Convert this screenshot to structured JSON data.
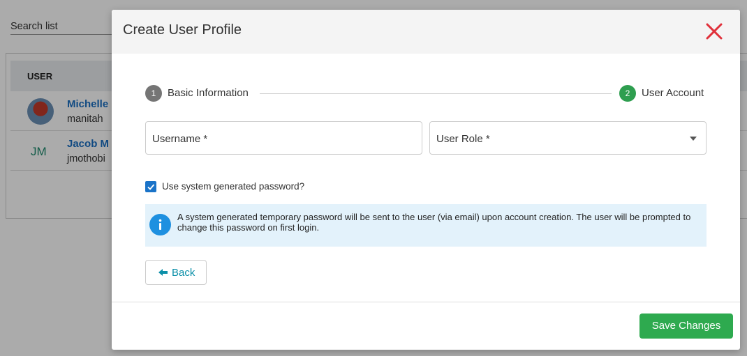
{
  "background": {
    "search_placeholder": "Search list",
    "table_header": "USER",
    "rows": [
      {
        "name": "Michelle",
        "email": "manitah",
        "avatar": "photo"
      },
      {
        "name": "Jacob M",
        "email": "jmothobi",
        "initials": "JM"
      }
    ]
  },
  "modal": {
    "title": "Create User Profile",
    "close_icon": "close-icon",
    "steps": [
      {
        "number": "1",
        "label": "Basic Information",
        "state": "complete",
        "color": "#757575"
      },
      {
        "number": "2",
        "label": "User Account",
        "state": "active",
        "color": "#2e9e4f"
      }
    ],
    "fields": {
      "username_label": "Username *",
      "role_label": "User Role *"
    },
    "checkbox": {
      "label": "Use system generated password?",
      "checked": true
    },
    "info_text": "A system generated temporary password will be sent to the user (via email) upon account creation. The user will be prompted to change this password on first login.",
    "back_label": "Back",
    "save_label": "Save Changes"
  },
  "colors": {
    "close": "#e0303a",
    "accent_green": "#2eaa4f",
    "info_bg": "#e3f2fb",
    "info_icon": "#1e90e0",
    "checkbox": "#1a73c8",
    "link": "#1a6fc2"
  }
}
